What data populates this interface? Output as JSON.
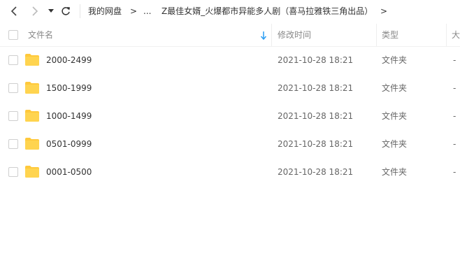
{
  "toolbar": {
    "breadcrumb": {
      "root": "我的网盘",
      "ellipsis": "...",
      "current": "Z最佳女婿_火爆都市异能多人剧（喜马拉雅铁三角出品）",
      "separator": ">"
    }
  },
  "table": {
    "headers": {
      "name": "文件名",
      "modified": "修改时间",
      "type": "类型",
      "size": "大"
    },
    "rows": [
      {
        "name": "2000-2499",
        "modified": "2021-10-28 18:21",
        "type": "文件夹",
        "size": "-"
      },
      {
        "name": "1500-1999",
        "modified": "2021-10-28 18:21",
        "type": "文件夹",
        "size": "-"
      },
      {
        "name": "1000-1499",
        "modified": "2021-10-28 18:21",
        "type": "文件夹",
        "size": "-"
      },
      {
        "name": "0501-0999",
        "modified": "2021-10-28 18:21",
        "type": "文件夹",
        "size": "-"
      },
      {
        "name": "0001-0500",
        "modified": "2021-10-28 18:21",
        "type": "文件夹",
        "size": "-"
      }
    ]
  },
  "colors": {
    "folder": "#ffc93c",
    "sort_arrow": "#2c9ef3"
  }
}
